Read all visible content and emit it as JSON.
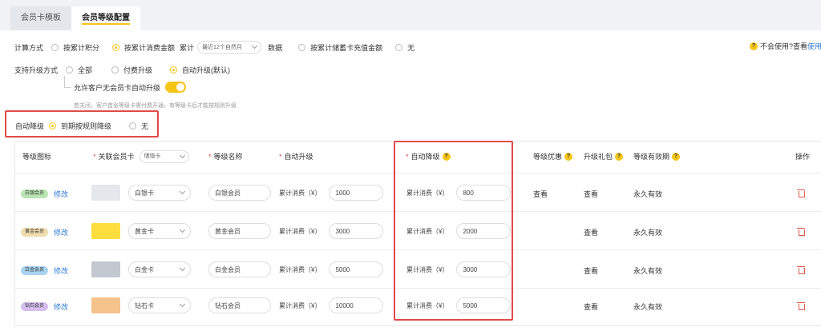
{
  "tabs": [
    {
      "label": "会员卡模板"
    },
    {
      "label": "会员等级配置"
    }
  ],
  "calc": {
    "label": "计算方式",
    "options": [
      "按累计积分",
      "按累计消费金额",
      "按累计储蓄卡充值金额",
      "无"
    ],
    "selected": 1,
    "cumulative_label": "累计",
    "period_select": "最近12个自然月",
    "data_label": "数据"
  },
  "help": {
    "text": "不会使用?查看",
    "link": "使用手"
  },
  "upgrade": {
    "label": "支持升级方式",
    "options": [
      "全部",
      "付费升级",
      "自动升级(默认)"
    ],
    "selected": 2,
    "allow_label": "允许客户无会员卡自动升级",
    "allow_on": true,
    "hint": "若关闭，客户首张等级卡需付费开通，有等级卡后才能按规则升级"
  },
  "downgrade": {
    "label": "自动降级",
    "options": [
      "到期按规则降级",
      "无"
    ],
    "selected": 0
  },
  "table": {
    "headers": {
      "icon": "等级图标",
      "card": "关联会员卡",
      "card_type": "储值卡",
      "name": "等级名称",
      "up": "自动升级",
      "down": "自动降级",
      "benefit": "等级优惠",
      "gift": "升级礼包",
      "validity": "等级有效期",
      "ops": "操作"
    },
    "edit_label": "修改",
    "unit_label": "累计消费（¥）",
    "rows": [
      {
        "badge": "白银会员",
        "badge_color": "#b9e6b4",
        "swatch": "#e4e7ec",
        "card": "白银卡",
        "name": "白银会员",
        "up": "1000",
        "down": "800",
        "benefit": "查看",
        "gift": "查看",
        "validity": "永久有效"
      },
      {
        "badge": "黄金会员",
        "badge_color": "#f0dcae",
        "swatch": "#fedd3e",
        "card": "黄金卡",
        "name": "黄金会员",
        "up": "3000",
        "down": "2000",
        "benefit": "",
        "gift": "查看",
        "validity": "永久有效"
      },
      {
        "badge": "白金会员",
        "badge_color": "#a9d3ee",
        "swatch": "#c3c8d0",
        "card": "白金卡",
        "name": "白金会员",
        "up": "5000",
        "down": "3000",
        "benefit": "",
        "gift": "查看",
        "validity": "永久有效"
      },
      {
        "badge": "钻石会员",
        "badge_color": "#d6bfef",
        "swatch": "#f6c28c",
        "card": "钻石卡",
        "name": "钻石会员",
        "up": "10000",
        "down": "5000",
        "benefit": "",
        "gift": "查看",
        "validity": "永久有效"
      }
    ]
  },
  "colors": {
    "accent": "#f5c518",
    "highlight_box": "#e04a4a",
    "link": "#2d7ad6",
    "delete": "#e05a4a"
  }
}
